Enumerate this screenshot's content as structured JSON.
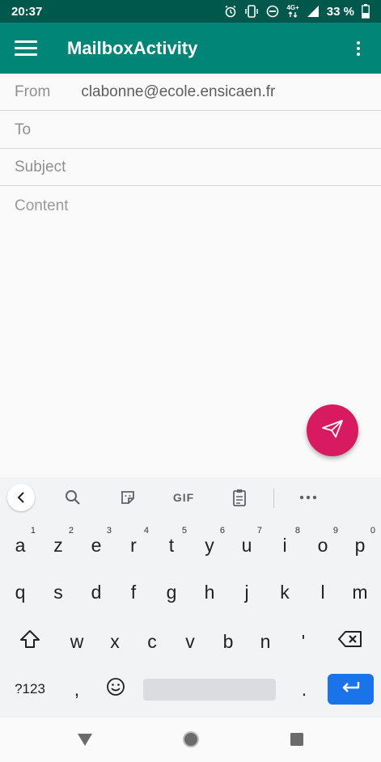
{
  "status_bar": {
    "time": "20:37",
    "network": "4G+",
    "battery": "33 %"
  },
  "app_bar": {
    "title": "MailboxActivity",
    "menu_icon": "hamburger-icon",
    "overflow_icon": "more-vert-icon"
  },
  "form": {
    "from_label": "From",
    "from_value": "clabonne@ecole.ensicaen.fr",
    "to_placeholder": "To",
    "subject_placeholder": "Subject",
    "content_placeholder": "Content"
  },
  "fab": {
    "icon": "send-icon",
    "color": "#d81b60"
  },
  "keyboard": {
    "toolbar": {
      "gif_label": "GIF",
      "icons": [
        "back-icon",
        "search-icon",
        "sticker-icon",
        "gif-icon",
        "clipboard-icon",
        "more-horiz-icon"
      ]
    },
    "row1": [
      "a",
      "z",
      "e",
      "r",
      "t",
      "y",
      "u",
      "i",
      "o",
      "p"
    ],
    "row1_hints": [
      "1",
      "2",
      "3",
      "4",
      "5",
      "6",
      "7",
      "8",
      "9",
      "0"
    ],
    "row2": [
      "q",
      "s",
      "d",
      "f",
      "g",
      "h",
      "j",
      "k",
      "l",
      "m"
    ],
    "row3": [
      "w",
      "x",
      "c",
      "v",
      "b",
      "n",
      "'"
    ],
    "symbols_label": "?123",
    "comma": ",",
    "period": "."
  },
  "colors": {
    "status_bar": "#00574b",
    "app_bar": "#008577",
    "accent": "#d81b60",
    "enter_key": "#1a73e8"
  }
}
